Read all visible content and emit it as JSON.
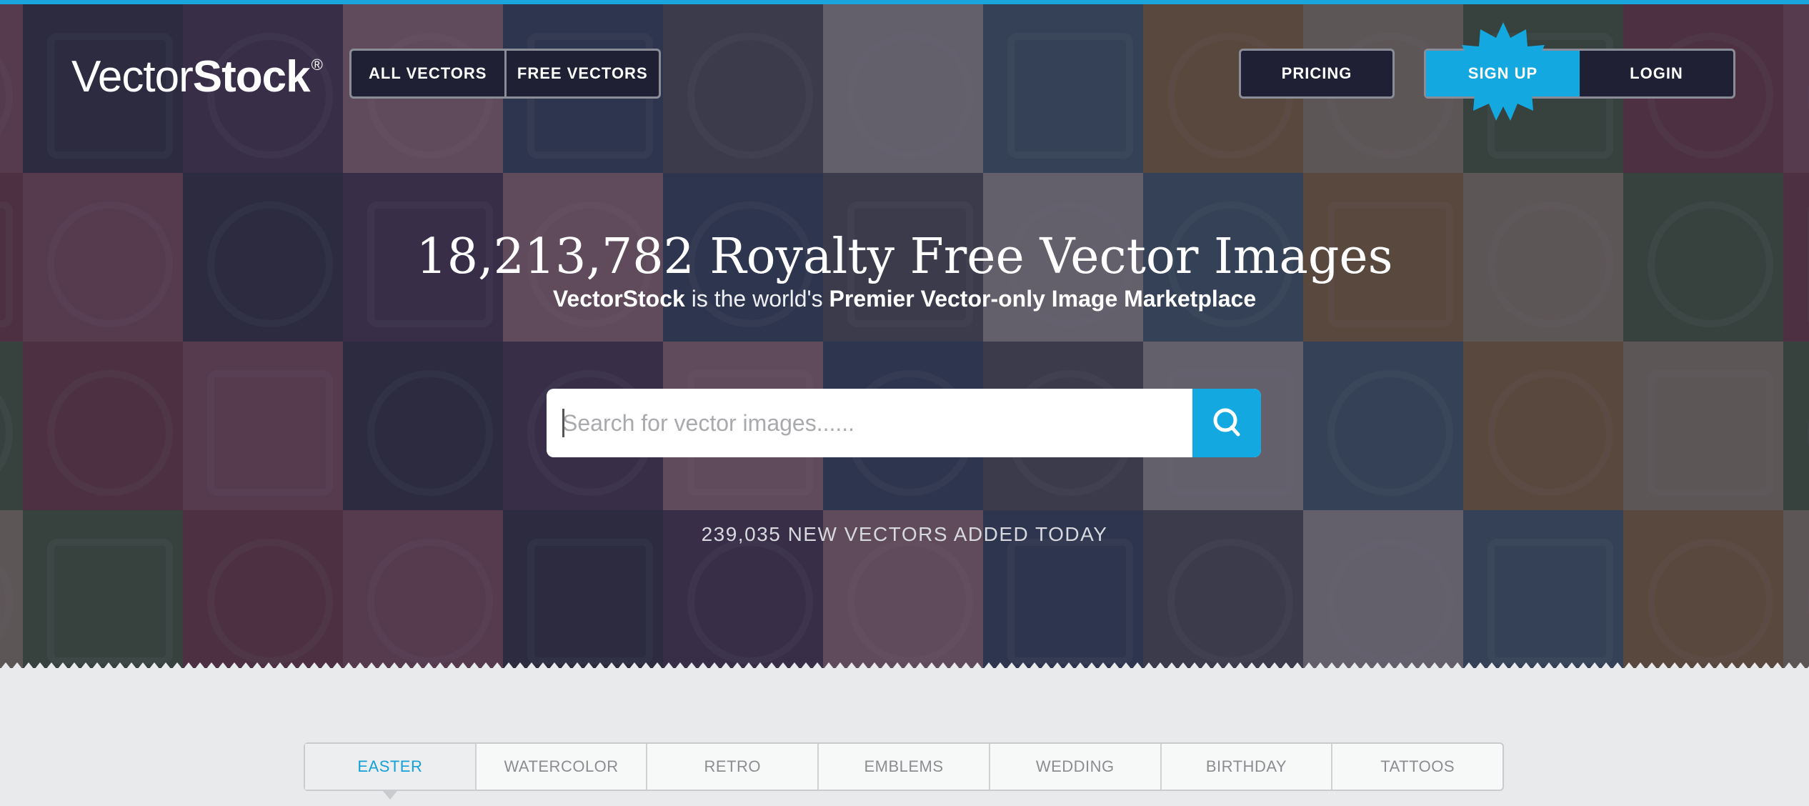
{
  "header": {
    "logo_part1": "Vector",
    "logo_part2": "Stock",
    "logo_mark": "®",
    "nav": {
      "all_vectors": "ALL VECTORS",
      "free_vectors": "FREE VECTORS"
    },
    "pricing": "PRICING",
    "sign_up": "SIGN UP",
    "login": "LOGIN"
  },
  "hero": {
    "headline": "18,213,782 Royalty Free Vector Images",
    "sub_brand": "VectorStock",
    "sub_middle": " is the world's ",
    "sub_strong": "Premier Vector-only Image Marketplace",
    "search_placeholder": "Search for vector images......",
    "search_icon": "search-icon",
    "new_today": "239,035 NEW VECTORS ADDED TODAY"
  },
  "categories": {
    "active_index": 0,
    "tabs": [
      "EASTER",
      "WATERCOLOR",
      "RETRO",
      "EMBLEMS",
      "WEDDING",
      "BIRTHDAY",
      "TATTOOS"
    ]
  },
  "colors": {
    "accent": "#14a8e0",
    "top_bar": "#1aa6dd",
    "page_bg": "#e8eaeb",
    "hero_overlay": "#302e42"
  }
}
